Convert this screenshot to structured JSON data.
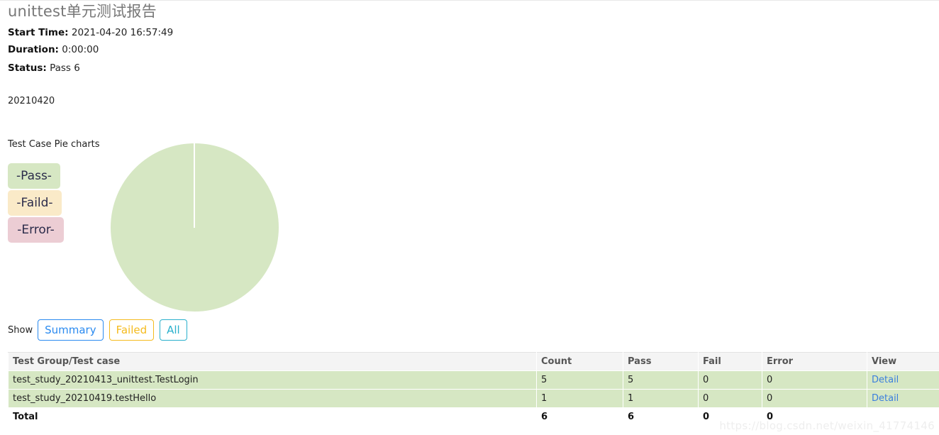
{
  "report": {
    "title": "unittest单元测试报告",
    "start_time_label": "Start Time:",
    "start_time_value": "2021-04-20 16:57:49",
    "duration_label": "Duration:",
    "duration_value": "0:00:00",
    "status_label": "Status:",
    "status_value": "Pass 6",
    "description": "20210420"
  },
  "pie_section": {
    "heading": "Test Case Pie charts",
    "legend": [
      {
        "label": "-Pass-",
        "color": "#d6e7c3"
      },
      {
        "label": "-Faild-",
        "color": "#faeac8"
      },
      {
        "label": "-Error-",
        "color": "#eccdd4"
      }
    ]
  },
  "chart_data": {
    "type": "pie",
    "title": "Test Case Pie charts",
    "categories": [
      "Pass",
      "Faild",
      "Error"
    ],
    "values": [
      6,
      0,
      0
    ],
    "percentages": [
      100,
      0,
      0
    ],
    "colors": [
      "#d6e7c3",
      "#faeac8",
      "#eccdd4"
    ],
    "legend_labels": [
      "-Pass-",
      "-Faild-",
      "-Error-"
    ],
    "legend_position": "left",
    "start_angle": 90,
    "total": 6
  },
  "show_controls": {
    "label": "Show",
    "buttons": [
      {
        "label": "Summary",
        "color": "#2a8af0"
      },
      {
        "label": "Failed",
        "color": "#f5bb1d"
      },
      {
        "label": "All",
        "color": "#29b0cc"
      }
    ]
  },
  "table": {
    "headers": [
      "Test Group/Test case",
      "Count",
      "Pass",
      "Fail",
      "Error",
      "View"
    ],
    "rows": [
      {
        "name": "test_study_20210413_unittest.TestLogin",
        "count": "5",
        "pass": "5",
        "fail": "0",
        "error": "0",
        "view": "Detail"
      },
      {
        "name": "test_study_20210419.testHello",
        "count": "1",
        "pass": "1",
        "fail": "0",
        "error": "0",
        "view": "Detail"
      }
    ],
    "total": {
      "name": "Total",
      "count": "6",
      "pass": "6",
      "fail": "0",
      "error": "0",
      "view": ""
    }
  },
  "watermark": {
    "text": "https://blog.csdn.net/weixin_41774146"
  }
}
